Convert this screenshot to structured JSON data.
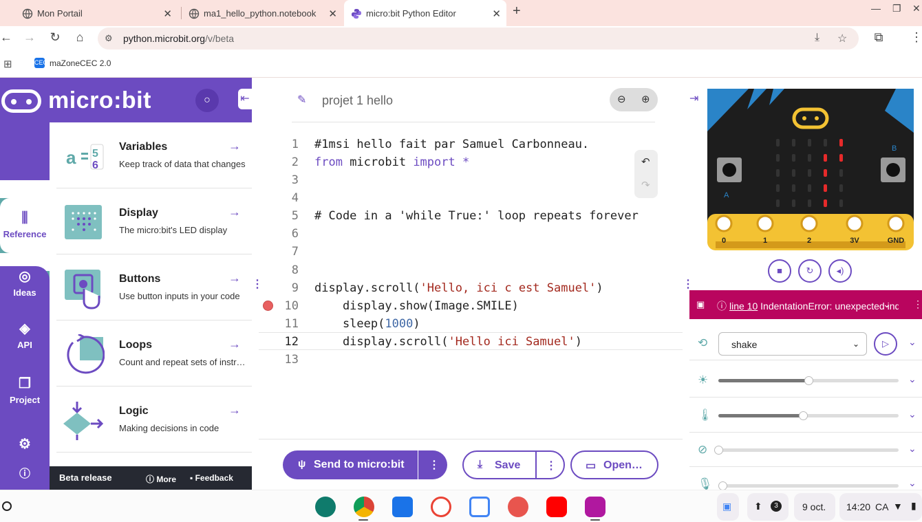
{
  "browser": {
    "tabs": [
      {
        "label": "Mon Portail"
      },
      {
        "label": "ma1_hello_python.notebook"
      },
      {
        "label": "micro:bit Python Editor"
      }
    ],
    "url_host": "python.microbit.org",
    "url_path": "/v/beta",
    "bookmark": "maZoneCEC 2.0",
    "bookmark_badge": "CEC"
  },
  "sidebar": {
    "brand": "micro:bit",
    "rail": [
      {
        "label": "Reference"
      },
      {
        "label": "Ideas"
      },
      {
        "label": "API"
      },
      {
        "label": "Project"
      }
    ],
    "items": [
      {
        "title": "Variables",
        "desc": "Keep track of data that changes"
      },
      {
        "title": "Display",
        "desc": "The micro:bit's LED display"
      },
      {
        "title": "Buttons",
        "desc": "Use button inputs in your code"
      },
      {
        "title": "Loops",
        "desc": "Count and repeat sets of instructions"
      },
      {
        "title": "Logic",
        "desc": "Making decisions in code"
      }
    ],
    "beta": {
      "label": "Beta release",
      "more": "More",
      "feedback": "Feedback"
    }
  },
  "editor": {
    "project_name": "projet 1 hello",
    "line_numbers": [
      "1",
      "2",
      "3",
      "4",
      "5",
      "6",
      "7",
      "8",
      "9",
      "10",
      "11",
      "12",
      "13"
    ],
    "code": {
      "l1": "#1msi hello fait par Samuel Carbonneau.",
      "l2_kw1": "from",
      "l2_mod": " microbit ",
      "l2_kw2": "import",
      "l2_star": " *",
      "l5": "# Code in a 'while True:' loop repeats forever",
      "l9_a": "display.scroll(",
      "l9_s": "'Hello, ici c est Samuel'",
      "l9_b": ")",
      "l10": "    display.show(Image.SMILE)",
      "l11_a": "    sleep(",
      "l11_n": "1000",
      "l11_b": ")",
      "l12_a": "    display.scroll(",
      "l12_s": "'Hello ici Samuel'",
      "l12_b": ")"
    },
    "send_label": "Send to micro:bit",
    "save_label": "Save",
    "open_label": "Open…"
  },
  "simulator": {
    "pins": [
      "0",
      "1",
      "2",
      "3V",
      "GND"
    ],
    "button_a": "A",
    "button_b": "B",
    "error_line": "line 10",
    "error_text": "IndentationError: unexpected indent",
    "gesture": "shake",
    "brightness_value": 0.5,
    "temperature_value": 0.47,
    "compass_value": 0.0
  },
  "shelf": {
    "notif_count": "3",
    "date": "9 oct.",
    "time": "14:20",
    "locale": "CA"
  },
  "colors": {
    "brand": "#6c4bc1",
    "teal": "#5fa9a9",
    "error": "#b9055e"
  }
}
